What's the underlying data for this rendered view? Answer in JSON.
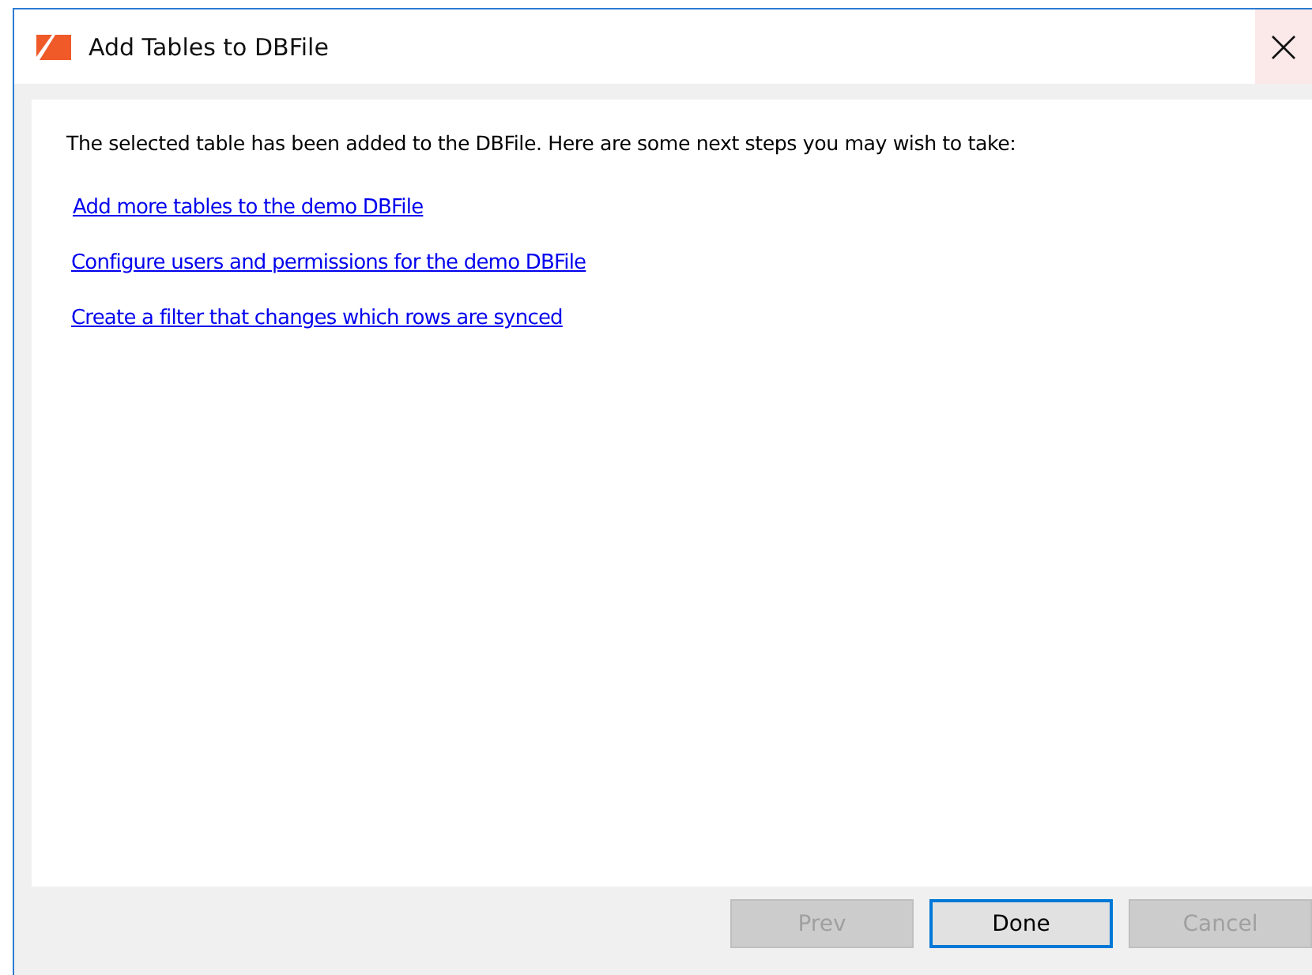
{
  "window": {
    "title": "Add Tables to DBFile"
  },
  "message": "The selected table has been added to the DBFile. Here are some next steps you may wish to take:",
  "links": [
    "Add more tables to the demo DBFile",
    "Configure users and permissions for the demo DBFile",
    "Create a filter that changes which rows are synced"
  ],
  "buttons": [
    {
      "label": "Prev",
      "disabled": true,
      "focused": false
    },
    {
      "label": "Done",
      "disabled": false,
      "focused": true
    },
    {
      "label": "Cancel",
      "disabled": true,
      "focused": false
    }
  ]
}
